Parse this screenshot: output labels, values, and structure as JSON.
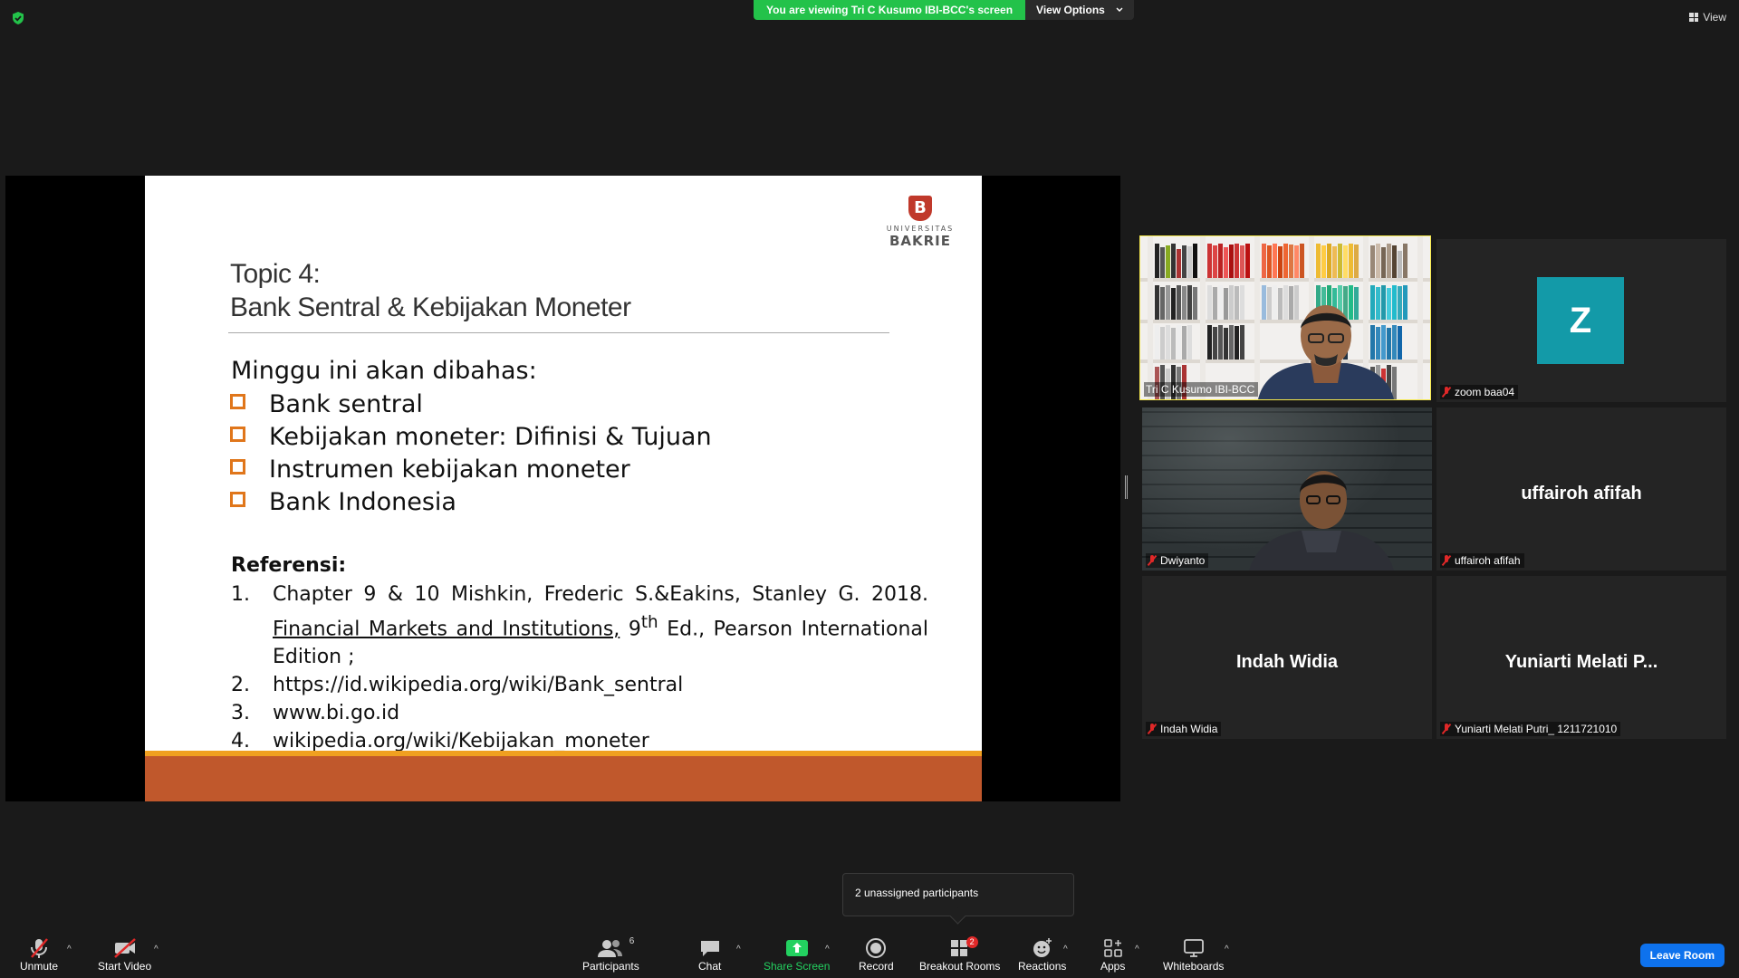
{
  "banner": {
    "viewing": "You are viewing Tri C Kusumo IBI-BCC's screen",
    "options": "View Options"
  },
  "view_button": "View",
  "slide": {
    "logo_letter": "B",
    "logo_univ": "UNIVERSITAS",
    "logo_name": "BAKRIE",
    "topic_line1": "Topic 4:",
    "topic_line2": "Bank Sentral & Kebijakan Moneter",
    "intro": "Minggu ini akan dibahas:",
    "bullets": [
      "Bank sentral",
      "Kebijakan moneter: Difinisi & Tujuan",
      "Instrumen kebijakan moneter",
      "Bank Indonesia"
    ],
    "ref_title": "Referensi:",
    "refs": [
      {
        "n": "1.",
        "pre": "Chapter 9 & 10 Mishkin, Frederic S.&Eakins, Stanley G. 2018. ",
        "u": "Financial Markets and Institutions,",
        "mid": " 9",
        "sup": "th",
        "post": " Ed., Pearson International Edition ;"
      },
      {
        "n": "2.",
        "text": "https://id.wikipedia.org/wiki/Bank_sentral"
      },
      {
        "n": "3.",
        "text": "www.bi.go.id"
      },
      {
        "n": "4.",
        "text": "wikipedia.org/wiki/Kebijakan_moneter"
      }
    ]
  },
  "participants": [
    {
      "name": "Tri C Kusumo IBI-BCC",
      "video": "bookshelf",
      "active": true,
      "muted": false
    },
    {
      "name": "zoom baa04",
      "avatar_letter": "Z",
      "muted": true
    },
    {
      "name": "Dwiyanto",
      "video": "stone",
      "muted": true
    },
    {
      "name": "uffairoh afifah",
      "center_name": "uffairoh afifah",
      "muted": true
    },
    {
      "name": "Indah Widia",
      "center_name": "Indah Widia",
      "muted": true
    },
    {
      "name": "Yuniarti Melati Putri_ 1211721010",
      "center_name": "Yuniarti Melati P...",
      "muted": true
    }
  ],
  "tooltip": "2 unassigned participants",
  "toolbar": {
    "unmute": "Unmute",
    "start_video": "Start Video",
    "participants": "Participants",
    "participants_count": "6",
    "chat": "Chat",
    "share_screen": "Share Screen",
    "record": "Record",
    "breakout_rooms": "Breakout Rooms",
    "breakout_badge": "2",
    "reactions": "Reactions",
    "apps": "Apps",
    "whiteboards": "Whiteboards",
    "leave": "Leave Room"
  },
  "colors": {
    "active_speaker": "#f6e94b",
    "green": "#23c24a",
    "leave": "#0e72ed",
    "slide_orange": "#e0761b",
    "slide_footer": "#c0582c"
  }
}
